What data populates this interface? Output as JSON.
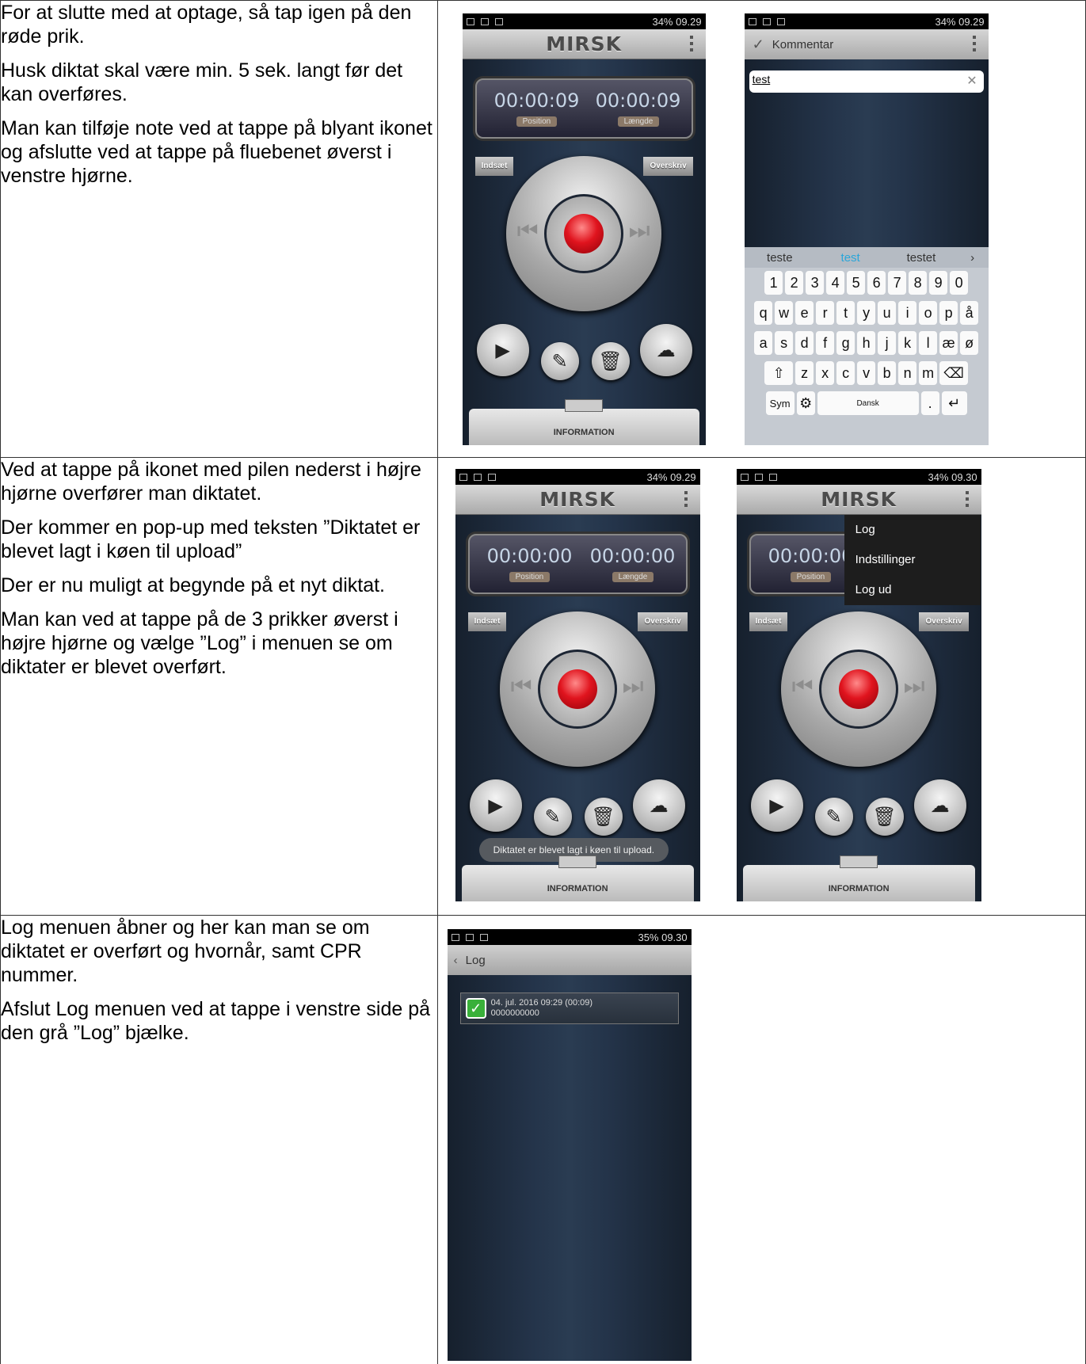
{
  "rows": [
    {
      "paragraphs": [
        "For at slutte med at optage, så tap igen på den røde prik.",
        "Husk diktat skal være min. 5 sek. langt før det kan overføres.",
        "Man kan tilføje note ved at tappe på blyant ikonet og afslutte ved at tappe på fluebenet øverst i venstre hjørne."
      ]
    },
    {
      "paragraphs": [
        "Ved at tappe på ikonet med pilen nederst i højre hjørne overfører man diktatet.",
        "Der kommer en pop-up med teksten ”Diktatet er blevet lagt i køen til upload”",
        "Der er nu muligt at begynde på et nyt diktat.",
        "Man kan ved at tappe på de 3 prikker øverst i højre hjørne og vælge ”Log” i menuen se om diktater er blevet overført."
      ]
    },
    {
      "paragraphs": [
        "Log menuen åbner og her kan man se om diktatet er overført og hvornår, samt CPR nummer.",
        "Afslut Log menuen ved at tappe i venstre side på den grå ”Log” bjælke."
      ]
    }
  ],
  "app": {
    "brand": "MIRSK",
    "position_label": "Position",
    "length_label": "Længde",
    "insert_label": "Indsæt",
    "overwrite_label": "Overskriv",
    "info_label": "INFORMATION"
  },
  "screens": {
    "recorder1": {
      "status": "34% 09.29",
      "position": "00:00:09",
      "length": "00:00:09"
    },
    "comment": {
      "status": "34% 09.29",
      "title": "Kommentar",
      "input": "test",
      "suggestions": [
        "teste",
        "test",
        "testet",
        "›"
      ],
      "keys_row1": [
        "1",
        "2",
        "3",
        "4",
        "5",
        "6",
        "7",
        "8",
        "9",
        "0"
      ],
      "keys_row2": [
        "q",
        "w",
        "e",
        "r",
        "t",
        "y",
        "u",
        "i",
        "o",
        "p",
        "å"
      ],
      "keys_row3": [
        "a",
        "s",
        "d",
        "f",
        "g",
        "h",
        "j",
        "k",
        "l",
        "æ",
        "ø"
      ],
      "keys_row4": [
        "z",
        "x",
        "c",
        "v",
        "b",
        "n",
        "m"
      ],
      "sym": "Sym",
      "lang": "Dansk"
    },
    "recorder2": {
      "status": "34% 09.29",
      "position": "00:00:00",
      "length": "00:00:00",
      "toast": "Diktatet er blevet lagt i køen til upload."
    },
    "recorder3": {
      "status": "34% 09.30",
      "position": "00:00:00",
      "menu": [
        "Log",
        "Indstillinger",
        "Log ud"
      ]
    },
    "log": {
      "status": "35% 09.30",
      "title": "Log",
      "entry_date": "04. jul. 2016 09:29 (00:09)",
      "entry_cpr": "0000000000"
    }
  }
}
